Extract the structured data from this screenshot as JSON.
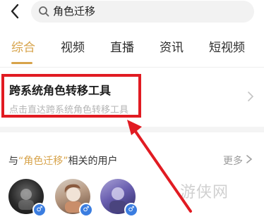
{
  "search": {
    "query": "角色迁移"
  },
  "tabs": [
    {
      "label": "综合",
      "active": true
    },
    {
      "label": "视频"
    },
    {
      "label": "直播"
    },
    {
      "label": "资讯"
    },
    {
      "label": "短视频"
    }
  ],
  "feature": {
    "title": "跨系统角色转移工具",
    "subtitle": "点击直达跨系统角色转移工具"
  },
  "users_section": {
    "prefix": "与",
    "keyword": "“角色迁移”",
    "suffix": "相关的用户",
    "more_label": "更多"
  },
  "avatars": [
    {
      "gender_icon": "male-icon"
    },
    {
      "gender_icon": "male-icon"
    },
    {
      "gender_icon": "male-icon"
    }
  ],
  "watermark": {
    "text": "游侠网"
  },
  "colors": {
    "accent": "#d7a34a",
    "highlight": "#e11b22",
    "badge": "#3b7de0"
  }
}
